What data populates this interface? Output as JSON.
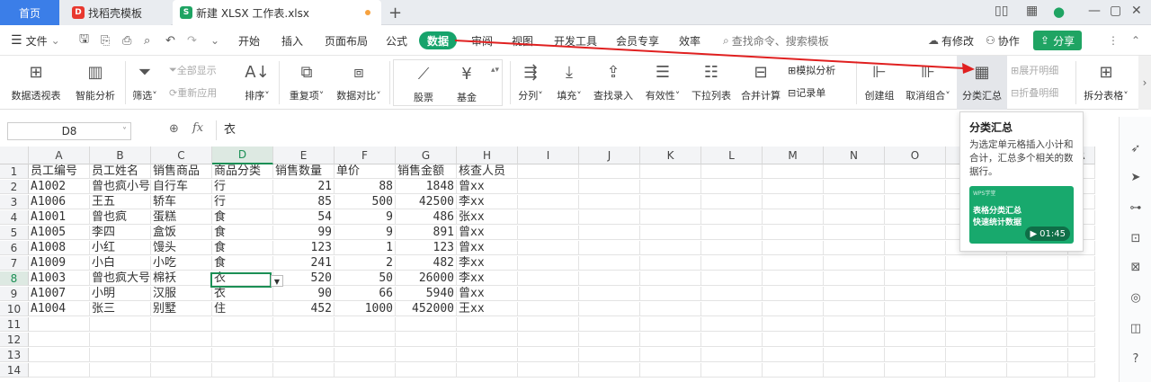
{
  "tabs": {
    "home": "首页",
    "template": "找稻壳模板",
    "file": "新建 XLSX 工作表.xlsx",
    "add": "+"
  },
  "menu": {
    "file": "文件",
    "items": [
      "开始",
      "插入",
      "页面布局",
      "公式",
      "数据",
      "审阅",
      "视图",
      "开发工具",
      "会员专享",
      "效率"
    ],
    "active": "数据",
    "search_placeholder": "查找命令、搜索模板",
    "modified": "有修改",
    "collab": "协作",
    "share": "分享"
  },
  "ribbon": {
    "pivot": "数据透视表",
    "smart": "智能分析",
    "filter": "筛选",
    "show_all": "全部显示",
    "reapply": "重新应用",
    "sort": "排序",
    "duplicates": "重复项",
    "compare": "数据对比",
    "stock": "股票",
    "fund": "基金",
    "split": "分列",
    "fill": "填充",
    "lookup": "查找录入",
    "validity": "有效性",
    "dropdown": "下拉列表",
    "consolidate": "合并计算",
    "simulate": "模拟分析",
    "record": "记录单",
    "group": "创建组",
    "ungroup": "取消组合",
    "subtotal": "分类汇总",
    "expand": "展开明细",
    "collapse": "折叠明细",
    "split_table": "拆分表格"
  },
  "formula": {
    "name_box": "D8",
    "fx": "fx",
    "value": "衣"
  },
  "tooltip": {
    "title": "分类汇总",
    "desc": "为选定单元格插入小计和合计，汇总多个相关的数据行。",
    "card_tag": "WPS学堂",
    "card_line1": "表格分类汇总",
    "card_line2": "快速统计数据",
    "duration": "01:45"
  },
  "sheet": {
    "columns": [
      "A",
      "B",
      "C",
      "D",
      "E",
      "F",
      "G",
      "H",
      "I",
      "J",
      "K",
      "L",
      "M",
      "N",
      "O",
      "P",
      "Q",
      "R"
    ],
    "selected_col": "D",
    "selected_row": "8",
    "row_numbers": [
      "1",
      "2",
      "3",
      "4",
      "5",
      "6",
      "7",
      "8",
      "9",
      "10",
      "11",
      "12",
      "13",
      "14"
    ],
    "header": [
      "员工编号",
      "员工姓名",
      "销售商品",
      "商品分类",
      "销售数量",
      "单价",
      "销售金额",
      "核查人员"
    ],
    "rows": [
      [
        "A1002",
        "曾也疯小号",
        "自行车",
        "行",
        "21",
        "88",
        "1848",
        "曾xx"
      ],
      [
        "A1006",
        "王五",
        "轿车",
        "行",
        "85",
        "500",
        "42500",
        "李xx"
      ],
      [
        "A1001",
        "曾也疯",
        "蛋糕",
        "食",
        "54",
        "9",
        "486",
        "张xx"
      ],
      [
        "A1005",
        "李四",
        "盒饭",
        "食",
        "99",
        "9",
        "891",
        "曾xx"
      ],
      [
        "A1008",
        "小红",
        "馒头",
        "食",
        "123",
        "1",
        "123",
        "曾xx"
      ],
      [
        "A1009",
        "小白",
        "小吃",
        "食",
        "241",
        "2",
        "482",
        "李xx"
      ],
      [
        "A1003",
        "曾也疯大号",
        "棉袄",
        "衣",
        "520",
        "50",
        "26000",
        "李xx"
      ],
      [
        "A1007",
        "小明",
        "汉服",
        "衣",
        "90",
        "66",
        "5940",
        "曾xx"
      ],
      [
        "A1004",
        "张三",
        "别墅",
        "住",
        "452",
        "1000",
        "452000",
        "王xx"
      ]
    ]
  },
  "colors": {
    "accent_green": "#16a36b",
    "home_blue": "#3b7ee8",
    "arrow_red": "#e02020"
  }
}
